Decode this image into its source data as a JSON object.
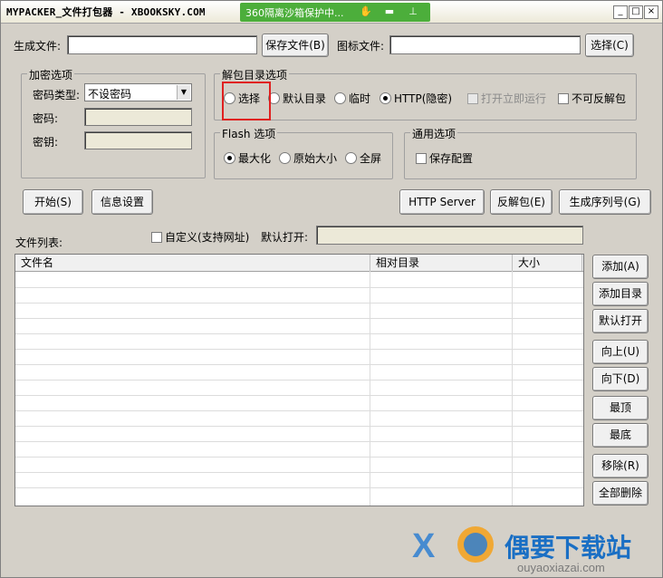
{
  "window": {
    "title": "MYPACKER_文件打包器 - XBOOKSKY.COM",
    "sandbox_label": "360隔离沙箱保护中...",
    "controls": [
      "_",
      "□",
      "×"
    ]
  },
  "top": {
    "output_label": "生成文件:",
    "output_value": "",
    "save_button": "保存文件(B)",
    "icon_label": "图标文件:",
    "icon_value": "",
    "select_button": "选择(C)"
  },
  "encrypt": {
    "group_title": "加密选项",
    "type_label": "密码类型:",
    "type_value": "不设密码",
    "password_label": "密码:",
    "key_label": "密钥:"
  },
  "extract": {
    "group_title": "解包目录选项",
    "options": [
      "选择",
      "默认目录",
      "临时",
      "HTTP(隐密)"
    ],
    "selected": "HTTP(隐密)",
    "open_after": "打开立即运行",
    "no_unpack": "不可反解包"
  },
  "flash": {
    "group_title": "Flash 选项",
    "options": [
      "最大化",
      "原始大小",
      "全屏"
    ],
    "selected": "最大化"
  },
  "common": {
    "group_title": "通用选项",
    "save_config": "保存配置"
  },
  "actions": {
    "start": "开始(S)",
    "info": "信息设置",
    "http_server": "HTTP Server",
    "unpack": "反解包(E)",
    "serial": "生成序列号(G)"
  },
  "files": {
    "list_label": "文件列表:",
    "custom_label": "自定义(支持网址)",
    "default_open_label": "默认打开:",
    "default_open_value": "",
    "columns": [
      "文件名",
      "相对目录",
      "大小"
    ]
  },
  "side_buttons": [
    "添加(A)",
    "添加目录",
    "默认打开",
    "向上(U)",
    "向下(D)",
    "最顶",
    "最底",
    "移除(R)",
    "全部删除"
  ],
  "watermark": {
    "brand": "偶要下载站",
    "url": "ouyaoxiazai.com"
  }
}
